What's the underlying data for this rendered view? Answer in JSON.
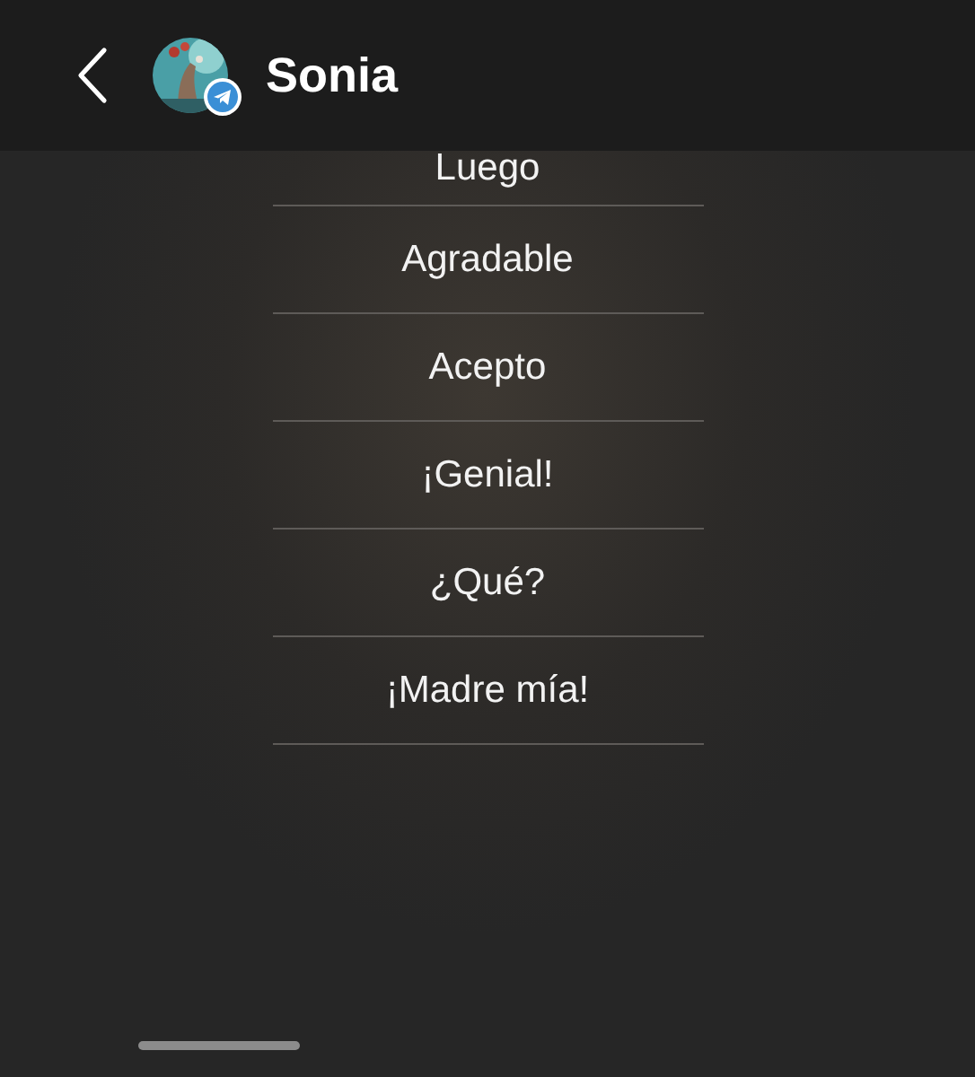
{
  "header": {
    "title": "Sonia"
  },
  "replies": [
    {
      "label": "Luego"
    },
    {
      "label": "Agradable"
    },
    {
      "label": "Acepto"
    },
    {
      "label": "¡Genial!"
    },
    {
      "label": "¿Qué?"
    },
    {
      "label": "¡Madre mía!"
    }
  ]
}
